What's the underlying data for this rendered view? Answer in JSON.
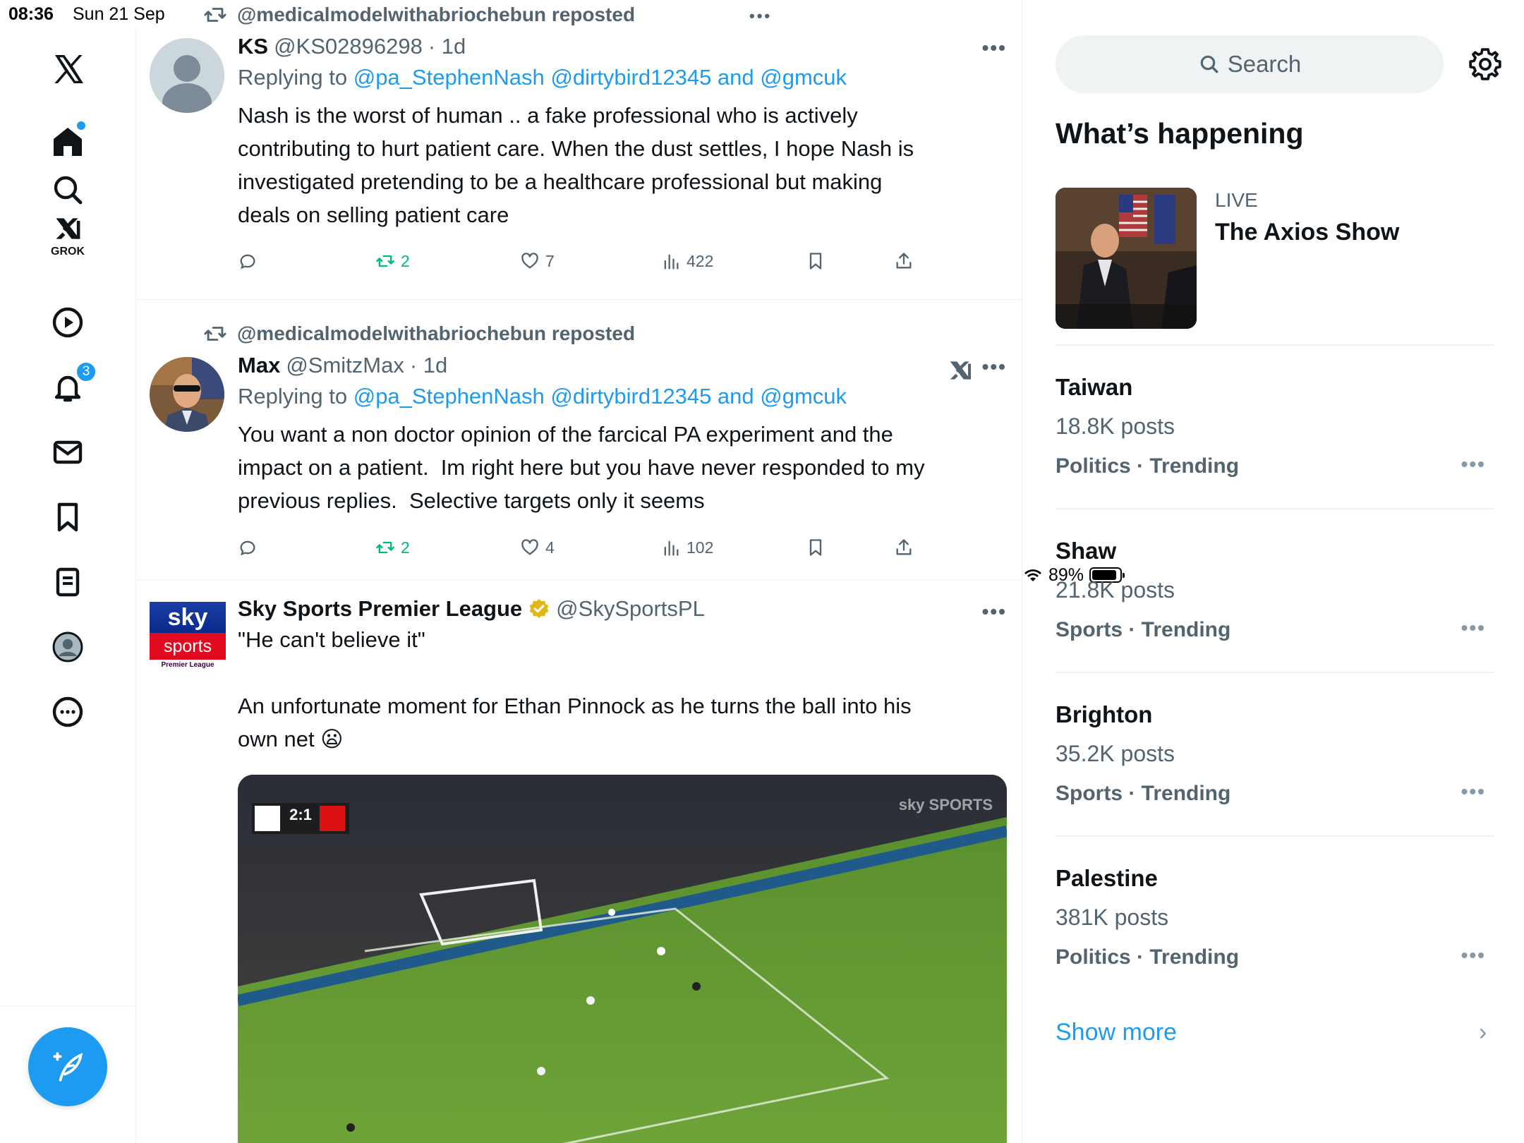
{
  "status_bar": {
    "time": "08:36",
    "date": "Sun 21 Sep",
    "battery": "89%",
    "battery_level": 0.89,
    "more_dots": "•••"
  },
  "nav": {
    "items": [
      "x-logo",
      "home",
      "explore",
      "grok",
      "videos",
      "notifications",
      "messages",
      "bookmarks",
      "lists",
      "profile",
      "more"
    ],
    "grok_label": "GROK",
    "notifications_count": "3"
  },
  "tweets": [
    {
      "repost_by": "@medicalmodelwithabriochebun reposted",
      "name": "KS",
      "handle": "@KS02896298",
      "time": "· 1d",
      "replying_prefix": "Replying to",
      "mentions": "@pa_StephenNash @dirtybird12345 and @gmcuk",
      "text": "Nash is the worst of human .. a fake professional who is actively\ncontributing to hurt patient care. When the dust settles, I hope Nash is\ninvestigated pretending to be a healthcare professional but making\ndeals on selling patient care",
      "reposts": "2",
      "likes": "7",
      "views": "422"
    },
    {
      "repost_by": "@medicalmodelwithabriochebun reposted",
      "name": "Max",
      "handle": "@SmitzMax",
      "time": "· 1d",
      "replying_prefix": "Replying to",
      "mentions": "@pa_StephenNash @dirtybird12345 and @gmcuk",
      "text": "You want a non doctor opinion of the farcical PA experiment and the\nimpact on a patient.  Im right here but you have never responded to my\nprevious replies.  Selective targets only it seems",
      "reposts": "2",
      "likes": "4",
      "views": "102"
    },
    {
      "name": "Sky Sports Premier League",
      "handle": "@SkySportsPL",
      "text": "\"He can't believe it\"\n\nAn unfortunate moment for Ethan Pinnock as he turns the ball into his\nown net 😦",
      "logo_sky": "sky",
      "logo_sports": "sports",
      "logo_pl": "Premier League",
      "video_score": "2:1",
      "video_broadcaster": "sky SPORTS"
    }
  ],
  "more_dots": "•••",
  "right": {
    "search_placeholder": "Search",
    "whats_happening": "What’s happening",
    "live": {
      "label": "LIVE",
      "title": "The Axios Show"
    },
    "trends": [
      {
        "name": "Taiwan",
        "posts": "18.8K posts",
        "category": "Politics · Trending"
      },
      {
        "name": "Shaw",
        "posts": "21.8K posts",
        "category": "Sports · Trending"
      },
      {
        "name": "Brighton",
        "posts": "35.2K posts",
        "category": "Sports · Trending"
      },
      {
        "name": "Palestine",
        "posts": "381K posts",
        "category": "Politics · Trending"
      }
    ],
    "show_more": "Show more",
    "chevron": "›"
  },
  "colors": {
    "accent": "#1d9bf0",
    "repost_green": "#00ba7c",
    "muted": "#536471",
    "verified_gold": "#e2b719"
  }
}
